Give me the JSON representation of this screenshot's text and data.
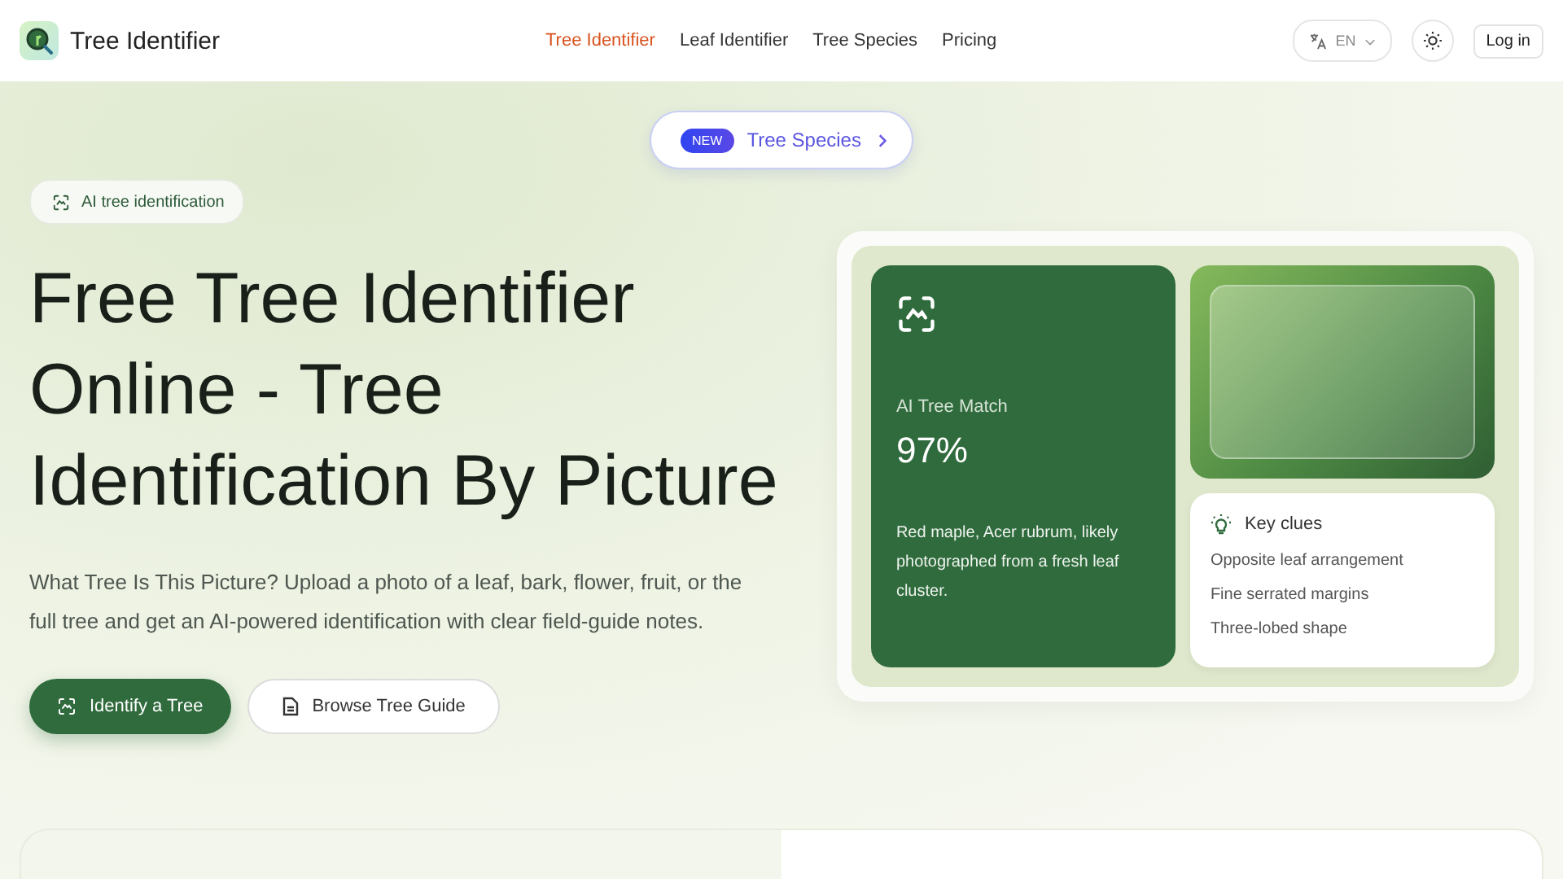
{
  "brand": {
    "name": "Tree Identifier"
  },
  "nav": [
    {
      "label": "Tree Identifier",
      "selected": true
    },
    {
      "label": "Leaf Identifier",
      "selected": false
    },
    {
      "label": "Tree Species",
      "selected": false
    },
    {
      "label": "Pricing",
      "selected": false
    }
  ],
  "language": {
    "value": "EN"
  },
  "login": "Log in",
  "announcement": {
    "badge": "NEW",
    "label": "Tree Species"
  },
  "hero": {
    "tag": "AI tree identification",
    "title": "Free Tree Identifier Online - Tree Identification By Picture",
    "description": "What Tree Is This Picture? Upload a photo of a leaf, bark, flower, fruit, or the full tree and get an AI-powered identification with clear field-guide notes.",
    "buttons": [
      {
        "label": "Identify a Tree",
        "kind": "primary"
      },
      {
        "label": "Browse Tree Guide",
        "kind": "secondary"
      }
    ]
  },
  "match_card": {
    "label": "AI Tree Match",
    "value": "97%",
    "description": "Red maple, Acer rubrum, likely photographed from a fresh leaf cluster."
  },
  "clues": {
    "title": "Key clues",
    "items": [
      "Opposite leaf arrangement",
      "Fine serrated margins",
      "Three-lobed shape"
    ]
  }
}
